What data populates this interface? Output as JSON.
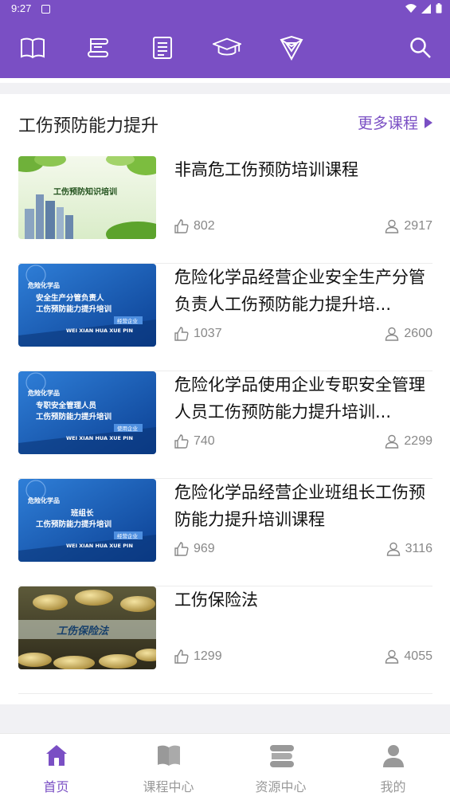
{
  "status": {
    "time": "9:27"
  },
  "top_icons": [
    "book-open-icon",
    "scroll-icon",
    "document-icon",
    "graduation-cap-icon",
    "shield-badge-icon",
    "search-icon"
  ],
  "section": {
    "title": "工伤预防能力提升",
    "more_label": "更多课程"
  },
  "courses": [
    {
      "title": "非高危工伤预防培训课程",
      "likes": "802",
      "views": "2917",
      "thumb_text": "工伤预防知识培训"
    },
    {
      "title": "危险化学品经营企业安全生产分管负责人工伤预防能力提升培...",
      "likes": "1037",
      "views": "2600",
      "thumb_lines": [
        "危险化学品",
        "安全生产分管负责人",
        "工伤预防能力提升培训",
        "经营企业",
        "WEI XIAN HUA XUE PIN"
      ]
    },
    {
      "title": "危险化学品使用企业专职安全管理人员工伤预防能力提升培训...",
      "likes": "740",
      "views": "2299",
      "thumb_lines": [
        "危险化学品",
        "专职安全管理人员",
        "工伤预防能力提升培训",
        "使用企业",
        "WEI XIAN HUA XUE PIN"
      ]
    },
    {
      "title": "危险化学品经营企业班组长工伤预防能力提升培训课程",
      "likes": "969",
      "views": "3116",
      "thumb_lines": [
        "危险化学品",
        "班组长",
        "工伤预防能力提升培训",
        "经营企业",
        "WEI XIAN HUA XUE PIN"
      ]
    },
    {
      "title": "工伤保险法",
      "likes": "1299",
      "views": "4055",
      "thumb_text": "工伤保险法"
    }
  ],
  "bottom_nav": [
    {
      "label": "首页",
      "icon": "home-icon",
      "active": true
    },
    {
      "label": "课程中心",
      "icon": "book-icon",
      "active": false
    },
    {
      "label": "资源中心",
      "icon": "resource-icon",
      "active": false
    },
    {
      "label": "我的",
      "icon": "user-icon",
      "active": false
    }
  ],
  "colors": {
    "brand": "#7a4fc4",
    "nav_inactive": "#999999"
  }
}
